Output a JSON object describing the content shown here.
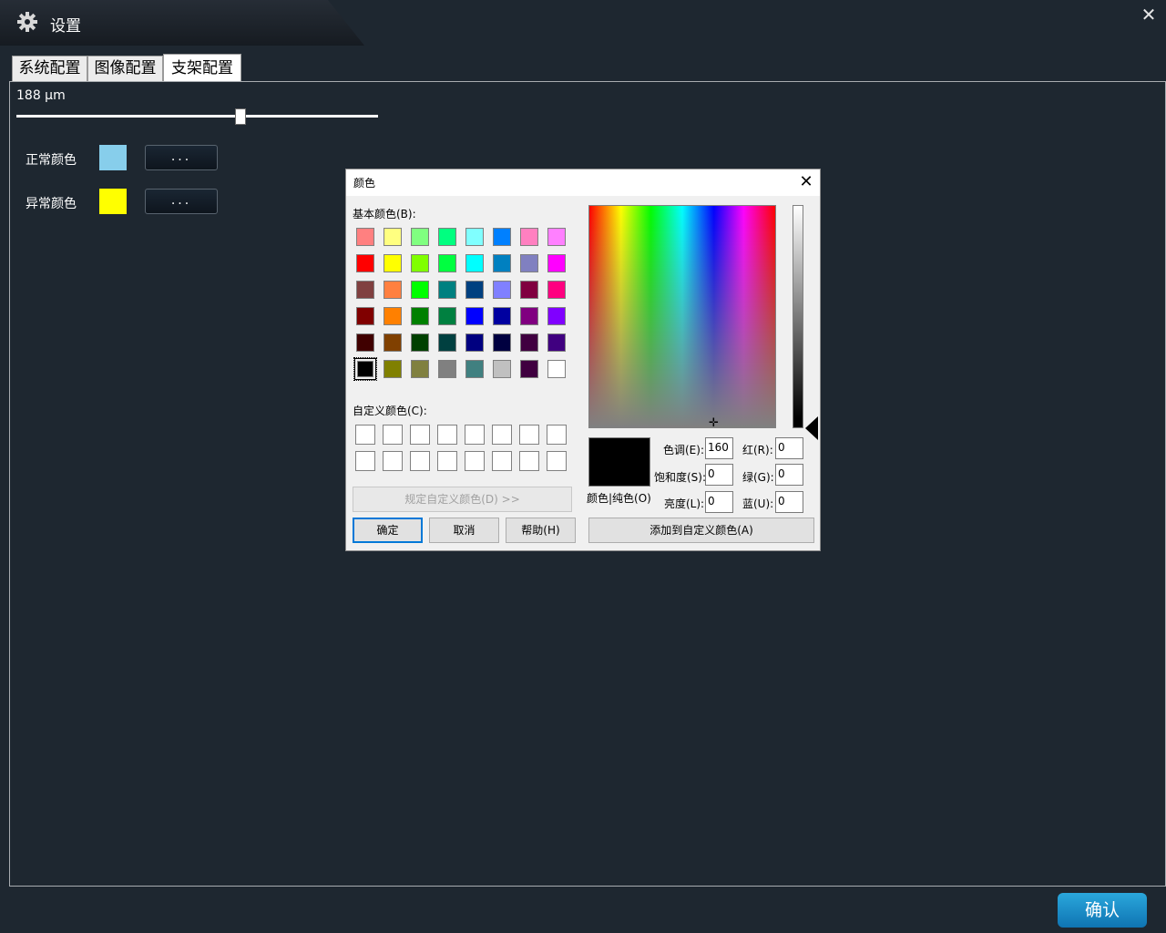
{
  "window": {
    "title": "设置",
    "title_icon": "gear-icon",
    "close_icon": "close-icon"
  },
  "tabs": [
    {
      "label": "系统配置",
      "active": false
    },
    {
      "label": "图像配置",
      "active": false
    },
    {
      "label": "支架配置",
      "active": true
    }
  ],
  "stent": {
    "size_label": "188 μm",
    "slider_fraction": 0.62,
    "normal_color": {
      "label": "正常颜色",
      "value": "#87ceeb",
      "button_label": "..."
    },
    "abnormal_color": {
      "label": "异常颜色",
      "value": "#ffff00",
      "button_label": "..."
    }
  },
  "confirm_label": "确认",
  "color_dialog": {
    "title": "颜色",
    "basic_colors_label": "基本颜色(B):",
    "basic_colors": [
      "#ff8080",
      "#ffff80",
      "#80ff80",
      "#00ff80",
      "#80ffff",
      "#0080ff",
      "#ff80c0",
      "#ff80ff",
      "#ff0000",
      "#ffff00",
      "#80ff00",
      "#00ff40",
      "#00ffff",
      "#0080c0",
      "#8080c0",
      "#ff00ff",
      "#804040",
      "#ff8040",
      "#00ff00",
      "#008080",
      "#004080",
      "#8080ff",
      "#800040",
      "#ff0080",
      "#800000",
      "#ff8000",
      "#008000",
      "#008040",
      "#0000ff",
      "#0000a0",
      "#800080",
      "#8000ff",
      "#400000",
      "#804000",
      "#004000",
      "#004040",
      "#000080",
      "#000040",
      "#400040",
      "#400080",
      "#000000",
      "#808000",
      "#808040",
      "#808080",
      "#408080",
      "#c0c0c0",
      "#400040",
      "#ffffff"
    ],
    "selected_basic_index": 40,
    "custom_colors_label": "自定义颜色(C):",
    "custom_colors": [
      "#ffffff",
      "#ffffff",
      "#ffffff",
      "#ffffff",
      "#ffffff",
      "#ffffff",
      "#ffffff",
      "#ffffff",
      "#ffffff",
      "#ffffff",
      "#ffffff",
      "#ffffff",
      "#ffffff",
      "#ffffff",
      "#ffffff",
      "#ffffff"
    ],
    "define_custom_label": "规定自定义颜色(D) >>",
    "ok_label": "确定",
    "cancel_label": "取消",
    "help_label": "帮助(H)",
    "preview_label": "颜色|纯色(O)",
    "preview_color": "#000000",
    "hue": {
      "label": "色调(E):",
      "value": "160"
    },
    "sat": {
      "label": "饱和度(S):",
      "value": "0"
    },
    "lum": {
      "label": "亮度(L):",
      "value": "0"
    },
    "red": {
      "label": "红(R):",
      "value": "0"
    },
    "green": {
      "label": "绿(G):",
      "value": "0"
    },
    "blue": {
      "label": "蓝(U):",
      "value": "0"
    },
    "add_custom_label": "添加到自定义颜色(A)"
  }
}
